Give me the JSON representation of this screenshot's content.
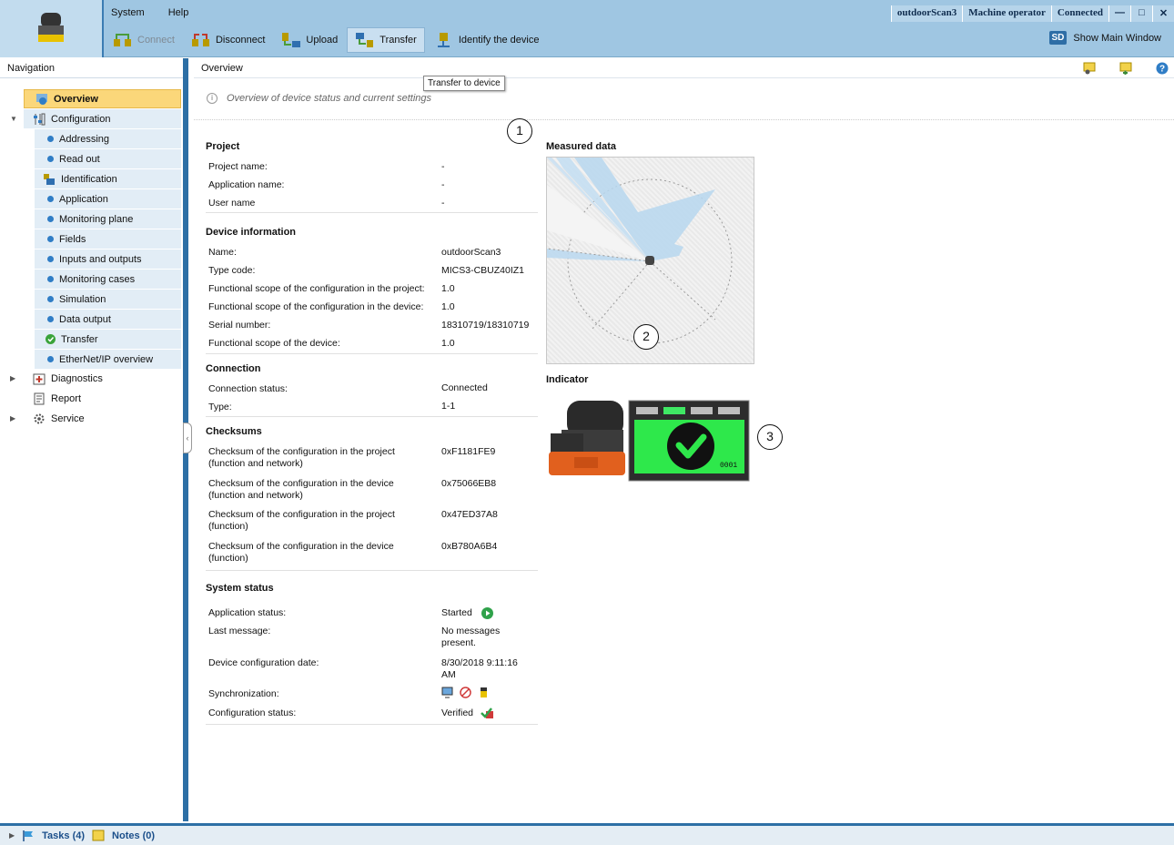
{
  "menu": [
    "System",
    "Help"
  ],
  "toolbar": {
    "connect": "Connect",
    "disconnect": "Disconnect",
    "upload": "Upload",
    "transfer": "Transfer",
    "identify": "Identify the device"
  },
  "status": {
    "device": "outdoorScan3",
    "role": "Machine operator",
    "connection": "Connected",
    "show_main": "Show Main Window",
    "show_main_icon": "SD"
  },
  "nav": {
    "title": "Navigation",
    "items": [
      {
        "label": "Overview"
      },
      {
        "label": "Configuration"
      },
      {
        "label": "Addressing"
      },
      {
        "label": "Read out"
      },
      {
        "label": "Identification"
      },
      {
        "label": "Application"
      },
      {
        "label": "Monitoring plane"
      },
      {
        "label": "Fields"
      },
      {
        "label": "Inputs and outputs"
      },
      {
        "label": "Monitoring cases"
      },
      {
        "label": "Simulation"
      },
      {
        "label": "Data output"
      },
      {
        "label": "Transfer"
      },
      {
        "label": "EtherNet/IP overview"
      },
      {
        "label": "Diagnostics"
      },
      {
        "label": "Report"
      },
      {
        "label": "Service"
      }
    ]
  },
  "main": {
    "title": "Overview",
    "tooltip": "Transfer to device",
    "subtitle": "Overview of device status and current settings",
    "info_icon": "i",
    "project": {
      "heading": "Project",
      "rows": [
        {
          "label": "Project name:",
          "value": "-"
        },
        {
          "label": "Application name:",
          "value": "-"
        },
        {
          "label": "User name",
          "value": "-"
        }
      ]
    },
    "device": {
      "heading": "Device information",
      "rows": [
        {
          "label": "Name:",
          "value": "outdoorScan3"
        },
        {
          "label": "Type code:",
          "value": "MICS3-CBUZ40IZ1"
        },
        {
          "label": "Functional scope of the configuration in the project:",
          "value": "1.0"
        },
        {
          "label": "Functional scope of the configuration in the device:",
          "value": "1.0"
        },
        {
          "label": "Serial number:",
          "value": "18310719/18310719"
        },
        {
          "label": "Functional scope of the device:",
          "value": "1.0"
        }
      ]
    },
    "connection": {
      "heading": "Connection",
      "rows": [
        {
          "label": "Connection status:",
          "value": "Connected"
        },
        {
          "label": "Type:",
          "value": "1-1"
        }
      ]
    },
    "checksums": {
      "heading": "Checksums",
      "rows": [
        {
          "label": "Checksum of the configuration in the project (function and network)",
          "value": "0xF1181FE9"
        },
        {
          "label": "Checksum of the configuration in the device (function and network)",
          "value": "0x75066EB8"
        },
        {
          "label": "Checksum of the configuration in the project (function)",
          "value": "0x47ED37A8"
        },
        {
          "label": "Checksum of the configuration in the device (function)",
          "value": "0xB780A6B4"
        }
      ]
    },
    "system": {
      "heading": "System status",
      "rows": [
        {
          "label": "Application status:",
          "value": "Started"
        },
        {
          "label": "Last message:",
          "value": "No messages present."
        },
        {
          "label": "Device configuration date:",
          "value": "8/30/2018 9:11:16 AM"
        },
        {
          "label": "Synchronization:",
          "value": ""
        },
        {
          "label": "Configuration status:",
          "value": "Verified"
        }
      ]
    },
    "measured_title": "Measured data",
    "indicator_title": "Indicator",
    "indicator_code": "0001",
    "callouts": [
      "1",
      "2",
      "3"
    ]
  },
  "bottom": {
    "tasks": "Tasks (4)",
    "notes": "Notes (0)"
  },
  "colors": {
    "topbar": "#9fc6e2",
    "accent": "#2d6fa5",
    "nav_selected": "#fbd77a",
    "display_green": "#2ee84b"
  }
}
